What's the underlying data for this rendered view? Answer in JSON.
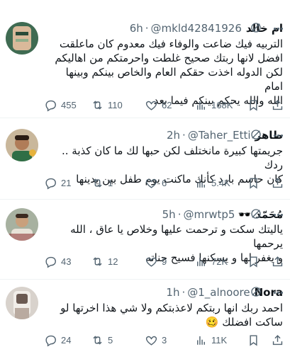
{
  "tweets": [
    {
      "name": "ام خالد",
      "handle": "@mkld42841926",
      "time": "6h",
      "lines": [
        "التربيه فيك ضاعت والوفاء فيك معدوم كان ماعلقت",
        "افضل لانها ربتك صحيح غلطت واحرمتكم من اهاليكم",
        "لكن الدوله اخذت حقكم العام والخاص بينكم وبينها امام",
        "الله والله يحكم بينكم فيما بعد"
      ],
      "replies": "455",
      "reposts": "110",
      "likes": "62",
      "views": "168K"
    },
    {
      "name": "طاهر",
      "handle": "@Taher_Etti",
      "time": "2h",
      "lines": [
        "جريمتها كبيرة مانختلف لكن حبها لك ما كان كذبة .. ردك",
        "كان حاسم بارد كأنك ماكنت يوم طفل بين يدينها"
      ],
      "replies": "21",
      "reposts": "1",
      "likes": "6",
      "views": "5.4K"
    },
    {
      "name": "مُحَمّد",
      "name_emoji": "🕶️",
      "handle": "@mrwtp5",
      "time": "5h",
      "lines": [
        "ياليتك سكت و ترحمت عليها وخلاص يا عاق ، الله يرحمها",
        "و يغفر لها و يسكنها فسيح جناته"
      ],
      "replies": "43",
      "reposts": "12",
      "likes": "9",
      "views": "72K"
    },
    {
      "name": "Nora",
      "handle": "@1_alnoore",
      "time": "1h",
      "lines": [
        "احمد ربك انها ربتكم لاعذبتكم ولا شي هذا اخرتها لو",
        "ساكت افضلك 🥴"
      ],
      "replies": "24",
      "reposts": "5",
      "likes": "3",
      "views": "11K"
    }
  ],
  "colors": {
    "text": "#0f1419",
    "secondary": "#536471",
    "divider": "#eff3f4"
  },
  "icons": [
    "reply-icon",
    "repost-icon",
    "like-icon",
    "views-icon",
    "bookmark-icon",
    "share-icon",
    "grok-icon",
    "more-icon"
  ]
}
